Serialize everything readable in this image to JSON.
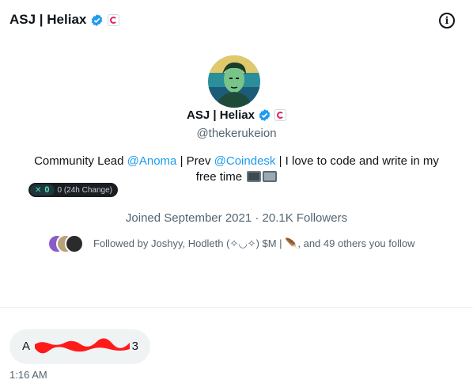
{
  "header": {
    "title": "ASJ | Heliax",
    "info_icon": "info-icon"
  },
  "profile": {
    "name": "ASJ | Heliax",
    "handle": "@thekerukeion",
    "bio_parts": {
      "part1": "Community Lead ",
      "mention1": "@Anoma",
      "part2": " | Prev ",
      "mention2": "@Coindesk",
      "part3": " | I love to code and write in my free time "
    },
    "widget": {
      "value": "0",
      "change_label": "0 (24h Change)"
    },
    "joined": "Joined September 2021 · 20.1K Followers",
    "followed_by": "Followed by Joshyy, Hodleth (✧◡✧) $M | 🪶, and 49 others you follow"
  },
  "message": {
    "text_start": "A",
    "text_end": "3",
    "time": "1:16 AM"
  },
  "colors": {
    "accent": "#1d9bf0",
    "text": "#0f1419",
    "secondary": "#536471",
    "bubble": "#eff3f4",
    "redaction": "#ff1a1a"
  }
}
